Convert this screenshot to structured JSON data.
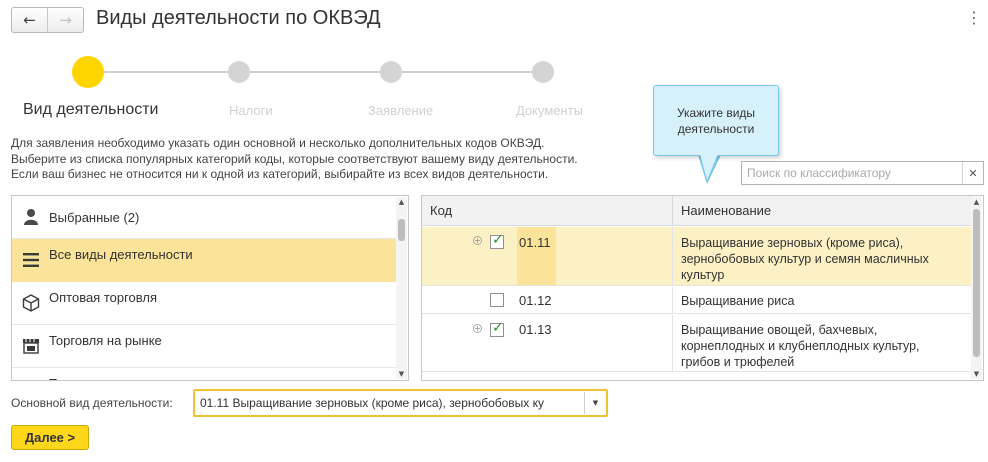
{
  "header": {
    "back_icon": "arrow-left-icon",
    "forward_icon": "arrow-right-icon",
    "title": "Виды деятельности по ОКВЭД",
    "more_icon": "more-vertical-icon"
  },
  "steps": [
    {
      "label": "Вид деятельности",
      "active": true
    },
    {
      "label": "Налоги",
      "active": false
    },
    {
      "label": "Заявление",
      "active": false
    },
    {
      "label": "Документы",
      "active": false
    }
  ],
  "tooltip": {
    "line1": "Укажите виды",
    "line2": "деятельности"
  },
  "instructions": [
    "Для заявления необходимо указать один основной и несколько дополнительных кодов ОКВЭД.",
    "Выберите из списка популярных категорий коды, которые соответствуют вашему виду деятельности.",
    "Если ваш бизнес не относится ни к одной из категорий, выбирайте из всех видов деятельности."
  ],
  "search": {
    "placeholder": "Поиск по классификатору",
    "clear_icon": "close-icon"
  },
  "categories": [
    {
      "label": "Выбранные (2)",
      "icon": "person-icon",
      "selected": false
    },
    {
      "label": "Все виды деятельности",
      "icon": "menu-lines-icon",
      "selected": true
    },
    {
      "label": "Оптовая торговля",
      "icon": "box-icon",
      "selected": false
    },
    {
      "label": "Торговля на рынке",
      "icon": "market-stall-icon",
      "selected": false
    },
    {
      "label": "Т",
      "icon": "item-icon",
      "selected": false
    }
  ],
  "table": {
    "columns": [
      "Код",
      "Наименование"
    ],
    "rows": [
      {
        "code": "01.11",
        "checked": true,
        "expandable": true,
        "highlighted": true,
        "name_lines": [
          "Выращивание зерновых (кроме риса),",
          "зернобобовых культур и семян масличных",
          "культур"
        ]
      },
      {
        "code": "01.12",
        "checked": false,
        "expandable": false,
        "highlighted": false,
        "name_lines": [
          "Выращивание риса"
        ]
      },
      {
        "code": "01.13",
        "checked": true,
        "expandable": true,
        "highlighted": false,
        "name_lines": [
          "Выращивание овощей, бахчевых,",
          "корнеплодных и клубнеплодных культур,",
          "грибов и трюфелей"
        ]
      }
    ]
  },
  "main_activity": {
    "label": "Основной вид деятельности:",
    "value": "01.11 Выращивание зерновых (кроме риса), зернобобовых ку"
  },
  "next_button": "Далее >",
  "colors": {
    "accent_yellow": "#ffd500",
    "selection": "#fbe39a",
    "tooltip_bg": "#d7f1fa",
    "tooltip_border": "#76c7e8",
    "check_green": "#2d8c2d"
  }
}
